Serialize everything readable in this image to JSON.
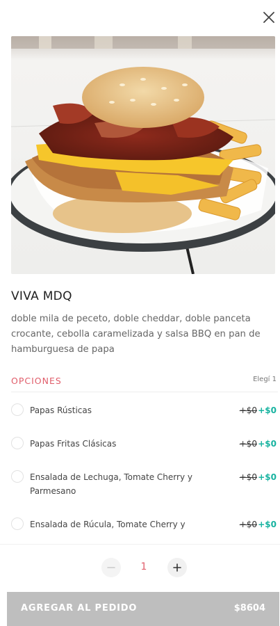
{
  "product": {
    "title": "VIVA MDQ",
    "description": "doble mila de peceto, doble cheddar, doble panceta crocante, cebolla caramelizada y salsa BBQ en pan de hamburguesa de papa"
  },
  "options": {
    "heading": "OPCIONES",
    "rule": "Elegí 1",
    "items": [
      {
        "label": "Papas Rústicas",
        "old_price": "+$0",
        "new_price": "+$0"
      },
      {
        "label": "Papas Fritas Clásicas",
        "old_price": "+$0",
        "new_price": "+$0"
      },
      {
        "label": "Ensalada de Lechuga, Tomate Cherry y Parmesano",
        "old_price": "+$0",
        "new_price": "+$0"
      },
      {
        "label": "Ensalada de Rúcula, Tomate Cherry y",
        "old_price": "+$0",
        "new_price": "+$0"
      }
    ]
  },
  "quantity": {
    "value": "1"
  },
  "cta": {
    "label": "AGREGAR AL PEDIDO",
    "price": "$8604"
  },
  "colors": {
    "accent": "#e05d6a",
    "price_green": "#18b3a0",
    "button_disabled": "#bebebe"
  },
  "icons": {
    "close": "close-icon",
    "minus": "minus-icon",
    "plus": "plus-icon"
  }
}
